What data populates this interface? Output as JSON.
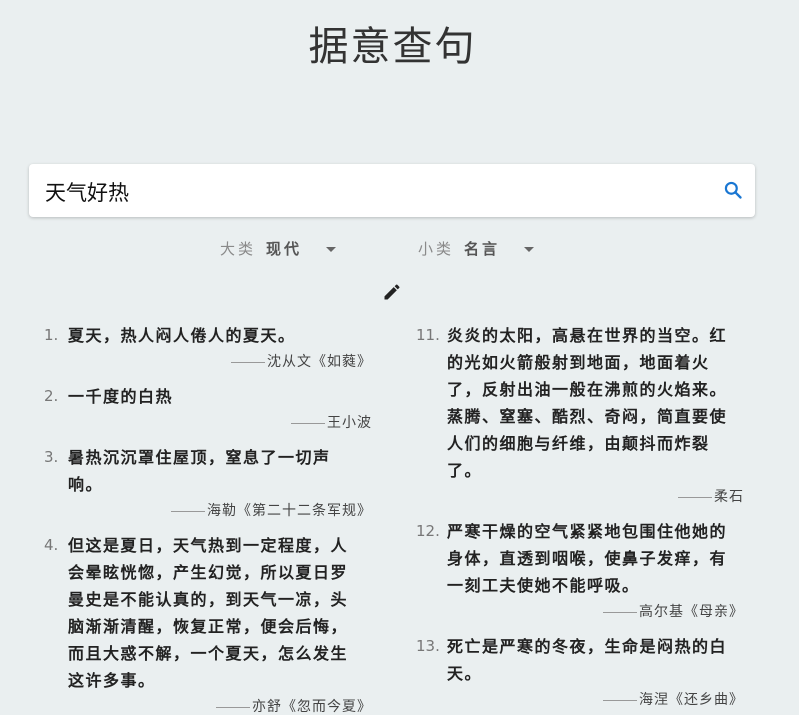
{
  "app": {
    "title": "据意查句"
  },
  "search": {
    "value": "天气好热",
    "placeholder": ""
  },
  "filters": {
    "category_label": "大类",
    "category_value": "现代",
    "subcategory_label": "小类",
    "subcategory_value": "名言"
  },
  "results": {
    "left": [
      {
        "num": "1.",
        "text": "夏天，热人闷人倦人的夏天。",
        "source": "沈从文《如蕤》"
      },
      {
        "num": "2.",
        "text": "一千度的白热",
        "source": "王小波"
      },
      {
        "num": "3.",
        "text": "暑热沉沉罩住屋顶，窒息了一切声响。",
        "source": "海勒《第二十二条军规》"
      },
      {
        "num": "4.",
        "text": "但这是夏日，天气热到一定程度，人会晕眩恍惚，产生幻觉，所以夏日罗曼史是不能认真的，到天气一凉，头脑渐渐清醒，恢复正常，便会后悔，而且大惑不解，一个夏天，怎么发生这许多事。",
        "source": "亦舒《忽而今夏》"
      }
    ],
    "right": [
      {
        "num": "11.",
        "text": "炎炎的太阳，高悬在世界的当空。红的光如火箭般射到地面，地面着火了，反射出油一般在沸煎的火焰来。蒸腾、窒塞、酷烈、奇闷，简直要使人们的细胞与纤维，由颠抖而炸裂了。",
        "source": "柔石"
      },
      {
        "num": "12.",
        "text": "严寒干燥的空气紧紧地包围住他她的身体，直透到咽喉，使鼻子发痒，有一刻工夫使她不能呼吸。",
        "source": "高尔基《母亲》"
      },
      {
        "num": "13.",
        "text": "死亡是严寒的冬夜，生命是闷热的白天。",
        "source": "海涅《还乡曲》"
      }
    ]
  }
}
